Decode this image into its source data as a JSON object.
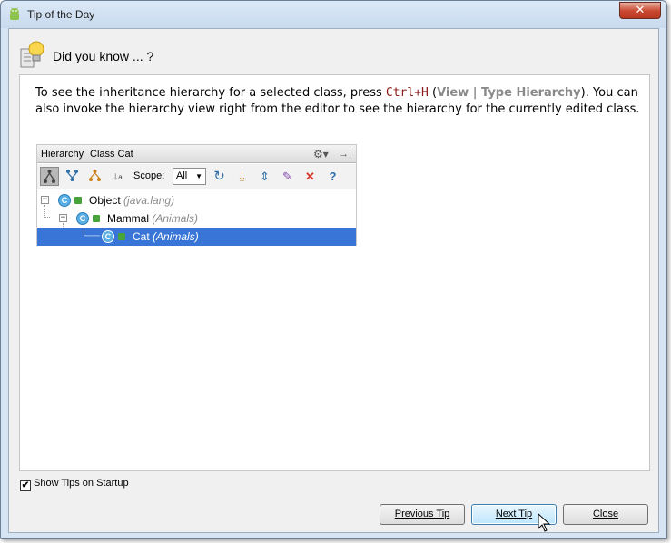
{
  "window": {
    "title": "Tip of the Day",
    "app_icon": "android-icon",
    "close_icon": "close-icon"
  },
  "header": {
    "title": "Did you know ... ?",
    "icon": "lightbulb-icon"
  },
  "tip": {
    "text_1": "To see the inheritance hierarchy for a selected class, press ",
    "shortcut": "Ctrl+H",
    "text_2": " (",
    "menu_path": "View | Type Hierarchy",
    "text_3": "). You can also invoke the hierarchy view right from the editor to see the hierarchy for the currently edited class."
  },
  "hierarchy": {
    "title": "Hierarchy",
    "subject": "Class Cat",
    "scope_label": "Scope:",
    "scope_value": "All",
    "tree": [
      {
        "name": "Object",
        "pkg": "(java.lang)"
      },
      {
        "name": "Mammal",
        "pkg": "(Animals)"
      },
      {
        "name": "Cat",
        "pkg": "(Animals)"
      }
    ]
  },
  "footer": {
    "show_tips_label": "Show Tips on Startup",
    "show_tips_checked": true,
    "previous_label": "Previous Tip",
    "next_label": "Next Tip",
    "close_label": "Close"
  }
}
